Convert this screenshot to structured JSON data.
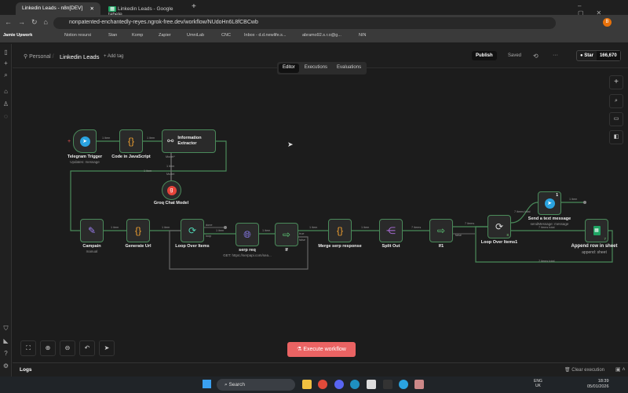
{
  "browser": {
    "tabs": [
      {
        "label": "Linkedin Leads - n8n[DEV]",
        "active": true
      },
      {
        "label": "Linkedin Leads - Google tabele",
        "active": false
      }
    ],
    "url": "nonpatented-enchantedly-reyes.ngrok-free.dev/workflow/NUdoHn6L8fCBCwb",
    "profile_initial": "B",
    "bookmarks": [
      "Jamie Upwork",
      "Notion resursi",
      "Stan",
      "Komp",
      "Zapier",
      "UmniLab",
      "CNC",
      "Inbox - d.d.newlife.s...",
      "abramo92.s.r.o@g...",
      "NIN"
    ]
  },
  "header": {
    "breadcrumb_owner": "Personal",
    "workflow_name": "Linkedin Leads",
    "add_tag": "+ Add tag",
    "publish": "Publish",
    "saved": "Saved",
    "more": "···",
    "star": "Star",
    "star_count": "166,670",
    "tabs": [
      {
        "label": "Editor",
        "active": true
      },
      {
        "label": "Executions"
      },
      {
        "label": "Evaluations"
      }
    ]
  },
  "nodes": [
    {
      "name": "Telegram Trigger",
      "sub": "Updates: message"
    },
    {
      "name": "Code in JavaScript"
    },
    {
      "name": "Information Extractor"
    },
    {
      "name": "Groq Chat Model"
    },
    {
      "name": "Campain",
      "sub": "manual"
    },
    {
      "name": "Generate Url"
    },
    {
      "name": "Loop Over Items"
    },
    {
      "name": "serp req",
      "sub": "GET: https://serpapi.com/sea..."
    },
    {
      "name": "If"
    },
    {
      "name": "Merge serp response"
    },
    {
      "name": "Split Out"
    },
    {
      "name": "If1"
    },
    {
      "name": "Loop Over Items1",
      "badge": "8"
    },
    {
      "name": "Send a text message",
      "sub": "sendMessage: message",
      "badge": "1"
    },
    {
      "name": "Append row in sheet",
      "sub": "append: sheet",
      "badge": "7"
    }
  ],
  "edge_labels": {
    "one": "1 item",
    "seven": "7 items",
    "seven_total": "7 items total",
    "model": "Model*",
    "model2": "Model",
    "done": "done",
    "loop": "loop",
    "true": "true",
    "false": "false"
  },
  "execute": "Execute workflow",
  "logs": {
    "title": "Logs",
    "clear": "Clear execution"
  },
  "taskbar": {
    "search": "Search",
    "lang": "ENG",
    "region": "UK",
    "time": "18:39",
    "date": "05/01/2026"
  }
}
